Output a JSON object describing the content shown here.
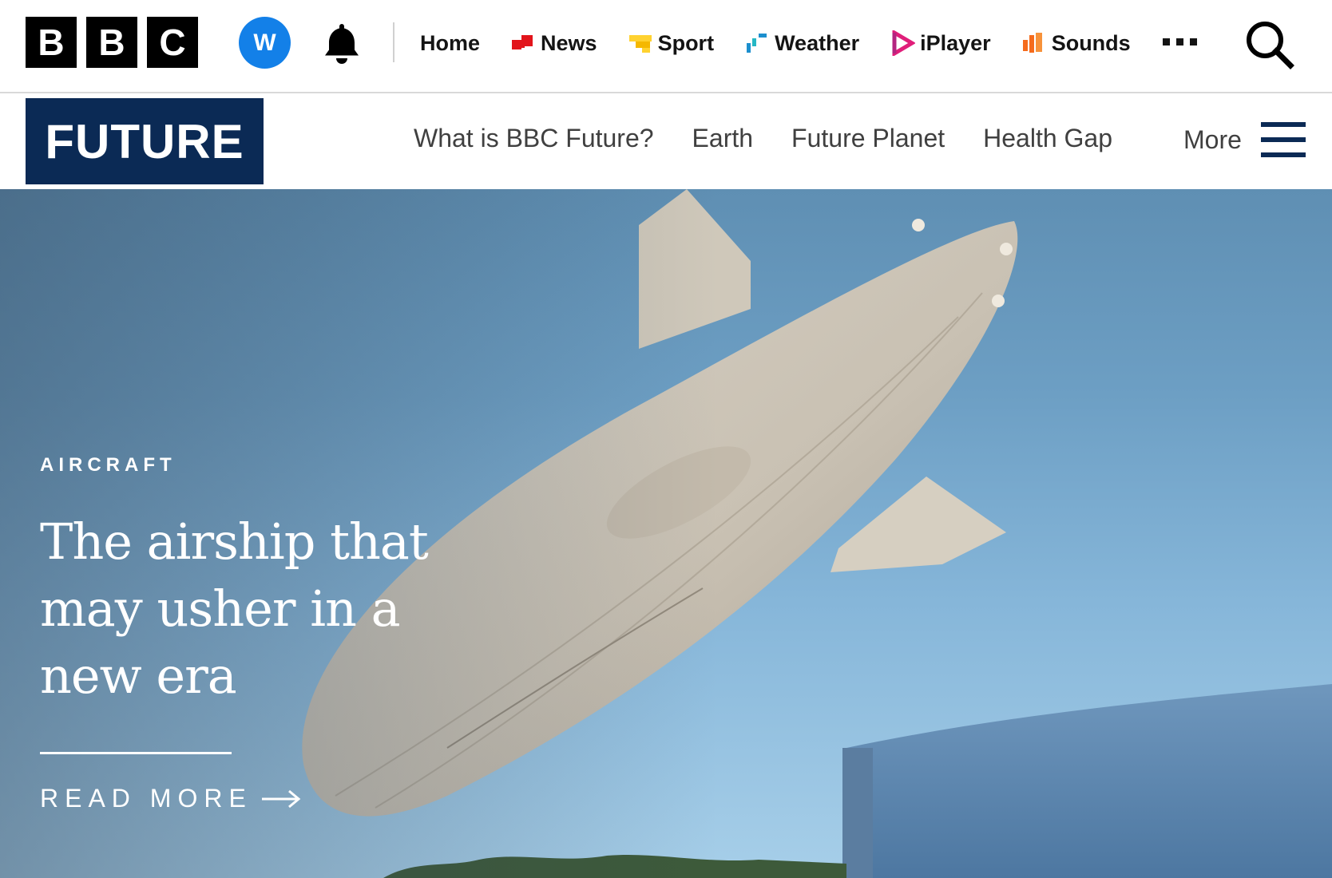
{
  "brand": {
    "logo_letters": [
      "B",
      "B",
      "C"
    ],
    "account_initial": "W",
    "account_color": "#1380e8"
  },
  "global_nav": {
    "items": [
      {
        "label": "Home",
        "icon": "none"
      },
      {
        "label": "News",
        "icon": "news-icon",
        "color": "#e2141b"
      },
      {
        "label": "Sport",
        "icon": "sport-icon",
        "color": "#ffd230"
      },
      {
        "label": "Weather",
        "icon": "weather-icon",
        "color": "#1c8fce"
      },
      {
        "label": "iPlayer",
        "icon": "iplayer-icon",
        "color": "#e01e7a"
      },
      {
        "label": "Sounds",
        "icon": "sounds-icon",
        "color": "#f56b1c"
      }
    ],
    "more_icon": "more-dots-icon",
    "search_icon": "search-icon"
  },
  "sub_header": {
    "section_title": "FUTURE",
    "section_color": "#0b2a55",
    "nav": [
      "What is BBC Future?",
      "Earth",
      "Future Planet",
      "Health Gap"
    ],
    "more_label": "More"
  },
  "hero": {
    "category": "AIRCRAFT",
    "headline": "The airship that may usher in a new era",
    "cta": "READ MORE"
  }
}
